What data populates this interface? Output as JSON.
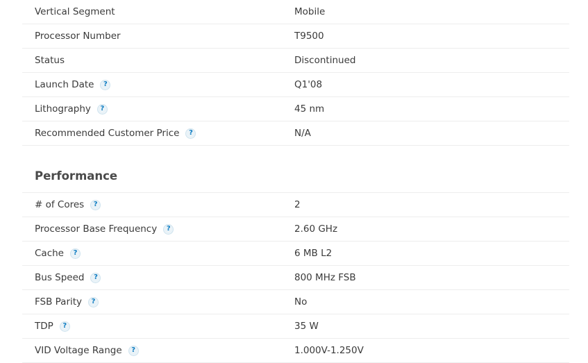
{
  "essentials": {
    "rows": [
      {
        "label": "Vertical Segment",
        "value": "Mobile",
        "help": false
      },
      {
        "label": "Processor Number",
        "value": "T9500",
        "help": false
      },
      {
        "label": "Status",
        "value": "Discontinued",
        "help": false
      },
      {
        "label": "Launch Date",
        "value": "Q1'08",
        "help": true
      },
      {
        "label": "Lithography",
        "value": "45 nm",
        "help": true
      },
      {
        "label": "Recommended Customer Price",
        "value": "N/A",
        "help": true
      }
    ]
  },
  "performance": {
    "title": "Performance",
    "rows": [
      {
        "label": "# of Cores",
        "value": "2",
        "help": true
      },
      {
        "label": "Processor Base Frequency",
        "value": "2.60 GHz",
        "help": true
      },
      {
        "label": "Cache",
        "value": "6 MB L2",
        "help": true
      },
      {
        "label": "Bus Speed",
        "value": "800 MHz FSB",
        "help": true
      },
      {
        "label": "FSB Parity",
        "value": "No",
        "help": true
      },
      {
        "label": "TDP",
        "value": "35 W",
        "help": true
      },
      {
        "label": "VID Voltage Range",
        "value": "1.000V-1.250V",
        "help": true
      }
    ]
  },
  "icons": {
    "help_glyph": "?",
    "help_icon_name": "help-icon",
    "help_color": "#0f7dc2"
  }
}
